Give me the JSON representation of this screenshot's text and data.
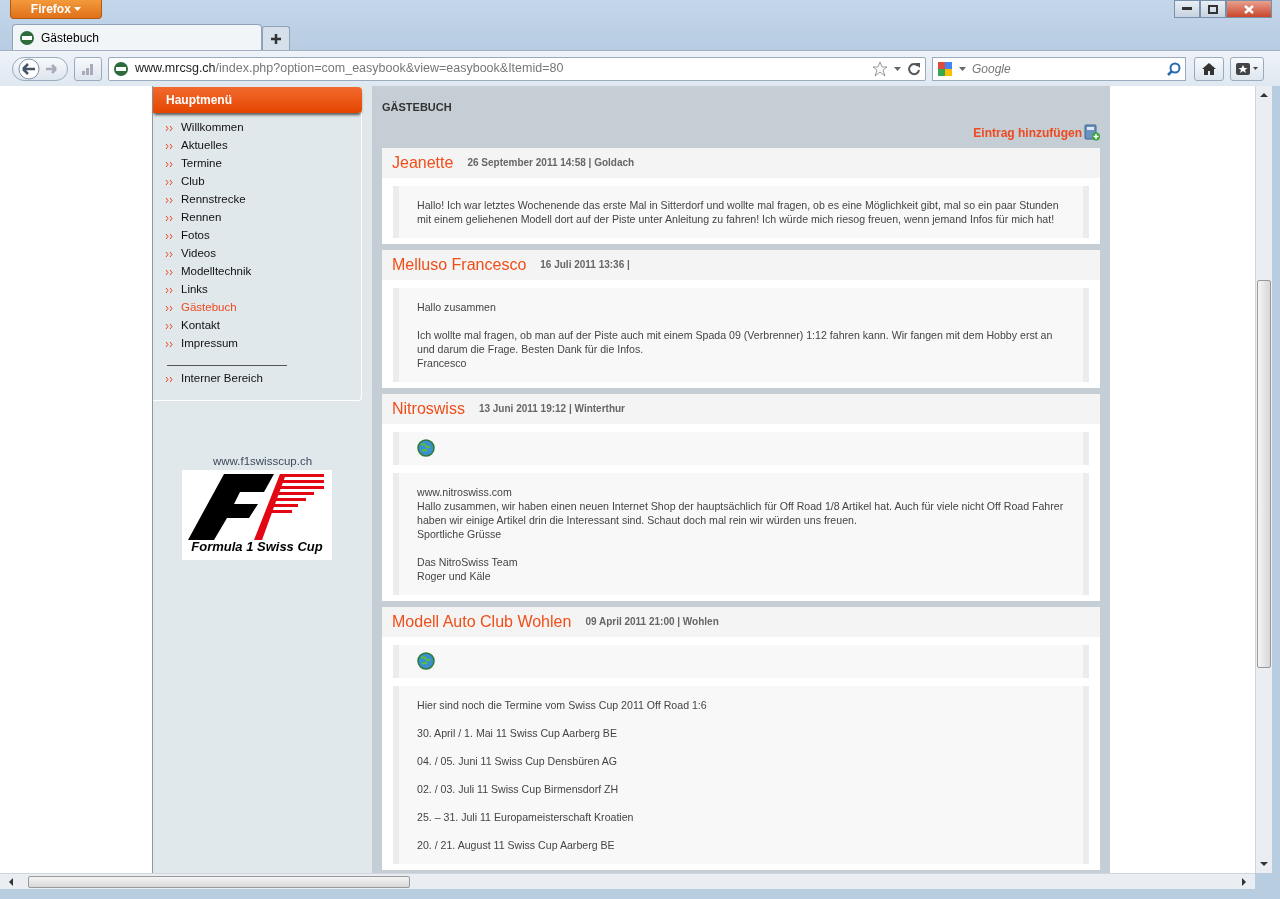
{
  "browser": {
    "app_button": "Firefox",
    "tabs": [
      {
        "title": "Gästebuch",
        "selected": true
      }
    ],
    "address": {
      "domain": "www.mrcsg.ch",
      "path": "/index.php?option=com_easybook&view=easybook&Itemid=80"
    },
    "search": {
      "placeholder": "Google"
    }
  },
  "sidebar": {
    "menu_title": "Hauptmenü",
    "items": [
      {
        "label": "Willkommen",
        "selected": false
      },
      {
        "label": "Aktuelles",
        "selected": false
      },
      {
        "label": "Termine",
        "selected": false
      },
      {
        "label": "Club",
        "selected": false
      },
      {
        "label": "Rennstrecke",
        "selected": false
      },
      {
        "label": "Rennen",
        "selected": false
      },
      {
        "label": "Fotos",
        "selected": false
      },
      {
        "label": "Videos",
        "selected": false
      },
      {
        "label": "Modelltechnik",
        "selected": false
      },
      {
        "label": "Links",
        "selected": false
      },
      {
        "label": "Gästebuch",
        "selected": true
      },
      {
        "label": "Kontakt",
        "selected": false
      },
      {
        "label": "Impressum",
        "selected": false
      }
    ],
    "secondary_items": [
      {
        "label": "Interner Bereich",
        "selected": false
      }
    ],
    "banner": {
      "caption": "www.f1swisscup.ch",
      "logo_text": "Formula 1 Swiss Cup"
    }
  },
  "content": {
    "heading": "GÄSTEBUCH",
    "add_link": "Eintrag hinzufügen",
    "entries": [
      {
        "name": "Jeanette",
        "meta": "26 September 2011 14:58 | Goldach",
        "website": false,
        "paragraphs": [
          [
            "Hallo! Ich war letztes Wochenende das erste Mal in Sitterdorf und wollte mal fragen, ob es eine Möglichkeit gibt, mal so ein paar Stunden mit einem geliehenen Modell dort auf der Piste unter Anleitung zu fahren! Ich würde mich riesog freuen, wenn jemand Infos für mich hat!"
          ]
        ]
      },
      {
        "name": "Melluso Francesco",
        "meta": "16 Juli 2011 13:36 |",
        "website": false,
        "paragraphs": [
          [
            "Hallo zusammen"
          ],
          [
            "Ich wollte mal fragen, ob man auf der Piste auch mit einem Spada 09 (Verbrenner) 1:12 fahren kann. Wir fangen mit dem Hobby erst an und darum die Frage. Besten Dank für die Infos.",
            "Francesco"
          ]
        ]
      },
      {
        "name": "Nitroswiss",
        "meta": "13 Juni 2011 19:12 | Winterthur",
        "website": true,
        "paragraphs": [
          [
            "www.nitroswiss.com",
            "Hallo zusammen, wir haben einen neuen Internet Shop der hauptsächlich für Off Road 1/8 Artikel hat. Auch für viele nicht Off Road Fahrer haben wir einige Artikel drin die Interessant sind. Schaut doch mal rein wir würden uns freuen.",
            "Sportliche Grüsse"
          ],
          [
            "Das NitroSwiss Team",
            "Roger und Käle"
          ]
        ]
      },
      {
        "name": "Modell Auto Club Wohlen",
        "meta": "09 April 2011 21:00 | Wohlen",
        "website": true,
        "paragraphs": [
          [
            "Hier sind noch die Termine vom Swiss Cup 2011 Off Road 1:6"
          ],
          [
            "30. April / 1. Mai 11 Swiss Cup Aarberg BE"
          ],
          [
            "04. / 05. Juni 11 Swiss Cup Densbüren AG"
          ],
          [
            "02. / 03. Juli 11 Swiss Cup Birmensdorf ZH"
          ],
          [
            "25. – 31. Juli 11 Europameisterschaft Kroatien"
          ],
          [
            "20. / 21. August 11 Swiss Cup Aarberg BE"
          ]
        ]
      }
    ]
  }
}
